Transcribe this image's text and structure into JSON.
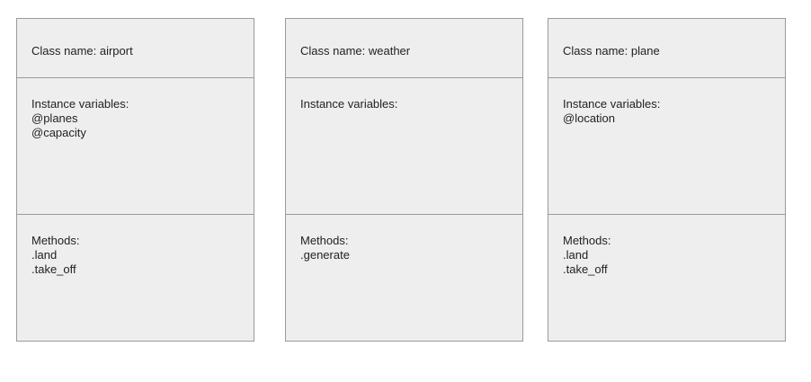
{
  "classes": [
    {
      "name_line": "Class name: airport",
      "vars_label": "Instance variables:",
      "vars": [
        "@planes",
        "@capacity"
      ],
      "methods_label": "Methods:",
      "methods": [
        ".land",
        ".take_off"
      ]
    },
    {
      "name_line": "Class name: weather",
      "vars_label": "Instance variables:",
      "vars": [],
      "methods_label": "Methods:",
      "methods": [
        ".generate"
      ]
    },
    {
      "name_line": "Class name: plane",
      "vars_label": "Instance variables:",
      "vars": [
        "@location"
      ],
      "methods_label": "Methods:",
      "methods": [
        ".land",
        ".take_off"
      ]
    }
  ]
}
